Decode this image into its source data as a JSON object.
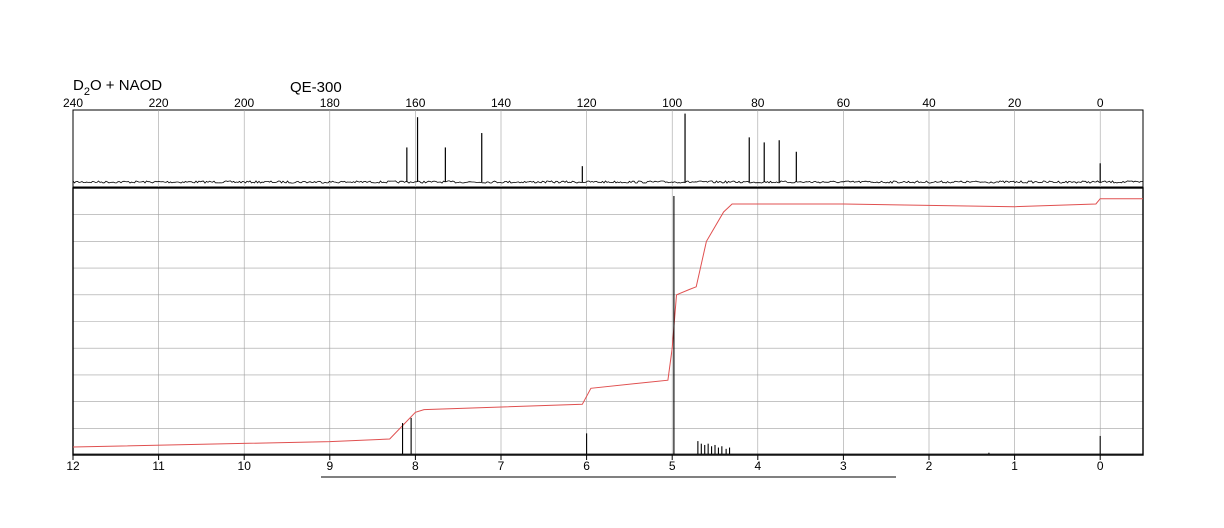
{
  "header": {
    "solvent_main": "D",
    "solvent_sub": "2",
    "solvent_rest": "O + NAOD",
    "instrument": "QE-300"
  },
  "colors": {
    "spectrum": "#000000",
    "integral": "#e05050",
    "grid": "#a0a0a0"
  },
  "chart_data": [
    {
      "type": "line",
      "name": "13C spectrum",
      "xlim": [
        240,
        -10
      ],
      "grid": true,
      "x_ticks": [
        240,
        220,
        200,
        180,
        160,
        140,
        120,
        100,
        80,
        60,
        40,
        20,
        0
      ],
      "peaks_ppm": [
        162.0,
        159.5,
        153.0,
        144.5,
        121.0,
        97.0,
        82.0,
        78.5,
        75.0,
        71.0,
        0.0
      ],
      "peak_heights": [
        0.48,
        0.9,
        0.48,
        0.68,
        0.22,
        0.95,
        0.62,
        0.55,
        0.58,
        0.42,
        0.26
      ]
    },
    {
      "type": "line",
      "name": "1H spectrum",
      "xlim": [
        12,
        -0.5
      ],
      "grid": true,
      "x_ticks": [
        12,
        11,
        10,
        9,
        8,
        7,
        6,
        5,
        4,
        3,
        2,
        1,
        0
      ],
      "peaks_ppm": [
        8.15,
        8.05,
        6.0,
        4.98,
        4.7,
        4.66,
        4.62,
        4.58,
        4.54,
        4.5,
        4.46,
        4.42,
        4.37,
        4.33,
        1.3,
        0.0
      ],
      "peak_heights": [
        0.12,
        0.14,
        0.08,
        1.0,
        0.05,
        0.04,
        0.035,
        0.04,
        0.03,
        0.035,
        0.025,
        0.03,
        0.02,
        0.025,
        0.005,
        0.07
      ],
      "integral": {
        "ppm": [
          12,
          9.0,
          8.3,
          8.0,
          7.9,
          6.05,
          5.95,
          5.05,
          5.0,
          4.95,
          4.8,
          4.72,
          4.6,
          4.4,
          4.3,
          3.0,
          1.0,
          0.05,
          0.0,
          -0.5
        ],
        "level": [
          0.03,
          0.05,
          0.06,
          0.16,
          0.17,
          0.19,
          0.25,
          0.28,
          0.4,
          0.6,
          0.62,
          0.63,
          0.8,
          0.91,
          0.94,
          0.94,
          0.93,
          0.94,
          0.96,
          0.96
        ]
      }
    }
  ]
}
